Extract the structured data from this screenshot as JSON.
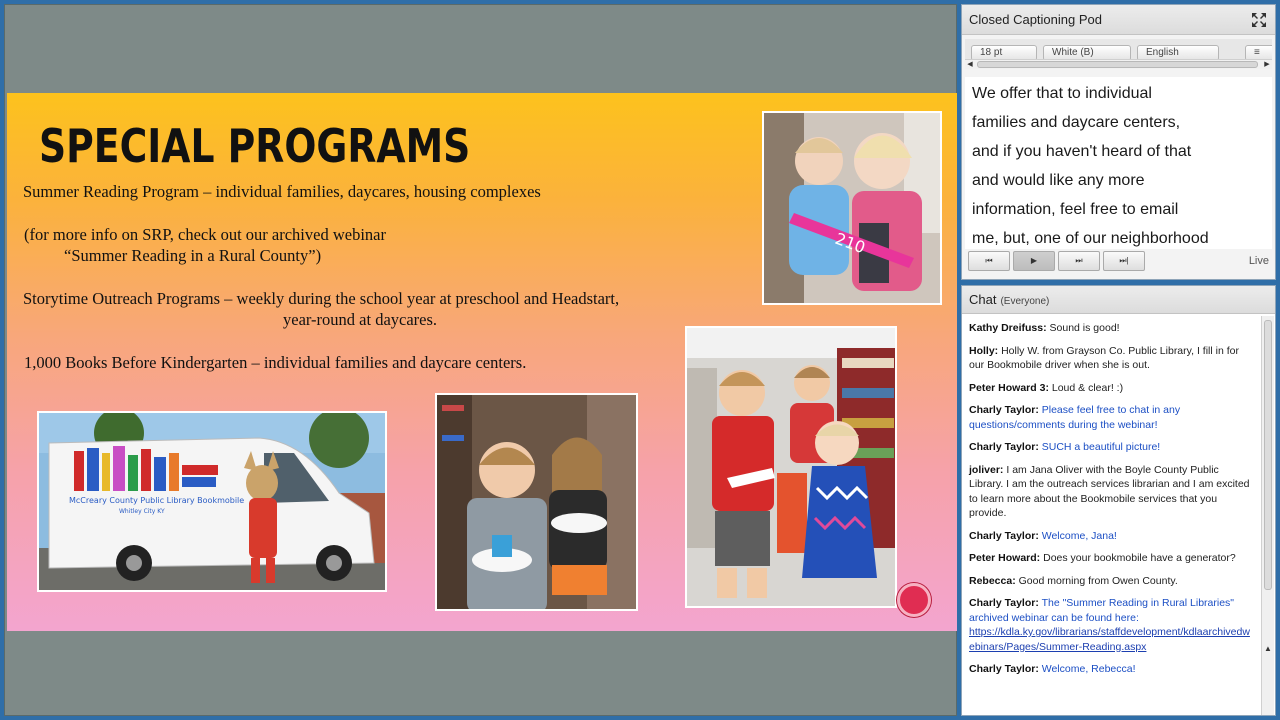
{
  "slide": {
    "title": "SPECIAL PROGRAMS",
    "lines": [
      "Summer Reading Program – individual families, daycares, housing complexes",
      "(for more info on SRP, check out our archived webinar",
      "“Summer Reading in a Rural County”)",
      "Storytime Outreach Programs – weekly during the school year at preschool and Headstart,",
      "year-round at daycares.",
      "1,000 Books Before Kindergarten – individual families and daycare centers."
    ],
    "van_text": "McCreary County Public Library Bookmobile",
    "van_subtext": "Whitley City KY"
  },
  "captioning": {
    "title": "Closed Captioning Pod",
    "font_size": "18 pt",
    "color": "White (B)",
    "language": "English",
    "lines": [
      "We offer that to individual",
      "families and daycare centers,",
      "and if you haven't heard of that",
      "and would like any more",
      "information, feel free to email",
      "me, but, one of our neighborhood"
    ],
    "live_label": "Live",
    "controls": [
      "⏮",
      "▶",
      "⏭",
      "⏭|"
    ]
  },
  "chat": {
    "title": "Chat",
    "scope": "(Everyone)",
    "messages": [
      {
        "who": "Kathy Dreifuss:",
        "text": "Sound is good!",
        "host": false
      },
      {
        "who": "Holly:",
        "text": "Holly W. from Grayson Co. Public Library, I fill in for our Bookmobile driver when she is out.",
        "host": false
      },
      {
        "who": "Peter Howard 3:",
        "text": "Loud & clear! :)",
        "host": false
      },
      {
        "who": "Charly Taylor:",
        "text": "Please feel free to chat in any questions/comments during the webinar!",
        "host": true
      },
      {
        "who": "Charly Taylor:",
        "text": "SUCH a beautiful picture!",
        "host": true
      },
      {
        "who": "joliver:",
        "text": "I am Jana Oliver with the Boyle County Public Library. I am the outreach services librarian and I am excited to learn more about the Bookmobile services that you provide.",
        "host": false
      },
      {
        "who": "Charly Taylor:",
        "text": "Welcome, Jana!",
        "host": true
      },
      {
        "who": "Peter Howard:",
        "text": "Does your bookmobile have a generator?",
        "host": false
      },
      {
        "who": "Rebecca:",
        "text": "Good morning from Owen County.",
        "host": false
      },
      {
        "who": "Charly Taylor:",
        "text": "The \"Summer Reading in Rural Libraries\" archived webinar can be found here:",
        "host": true,
        "link": "https://kdla.ky.gov/librarians/staffdevelopment/kdlaarchivedwebinars/Pages/Summer-Reading.aspx"
      },
      {
        "who": "Charly Taylor:",
        "text": "Welcome, Rebecca!",
        "host": true
      }
    ]
  },
  "colors": {
    "accent_host": "#1c4fc4",
    "record": "#e02d52",
    "slide_top": "#fdc21d",
    "slide_bottom": "#f3a5cf"
  }
}
